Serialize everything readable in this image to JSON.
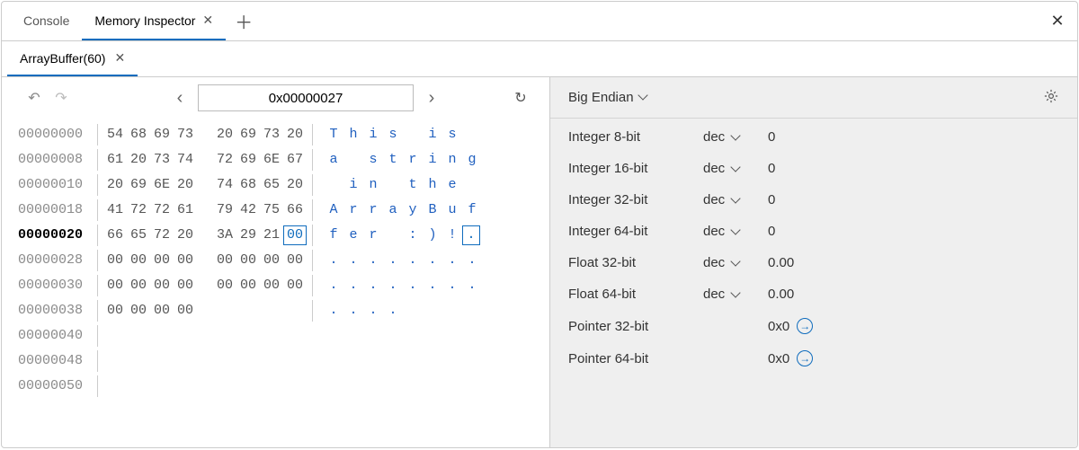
{
  "tabs": {
    "items": [
      {
        "label": "Console",
        "active": false,
        "closable": false
      },
      {
        "label": "Memory Inspector",
        "active": true,
        "closable": true
      }
    ]
  },
  "subtabs": {
    "items": [
      {
        "label": "ArrayBuffer(60)",
        "active": true
      }
    ]
  },
  "toolbar": {
    "address": "0x00000027"
  },
  "memory": {
    "selected_row_offset": "00000020",
    "selected_byte_col": 7,
    "rows": [
      {
        "offset": "00000000",
        "bytes": [
          "54",
          "68",
          "69",
          "73",
          "20",
          "69",
          "73",
          "20"
        ],
        "ascii": [
          "T",
          "h",
          "i",
          "s",
          " ",
          "i",
          "s",
          " "
        ]
      },
      {
        "offset": "00000008",
        "bytes": [
          "61",
          "20",
          "73",
          "74",
          "72",
          "69",
          "6E",
          "67"
        ],
        "ascii": [
          "a",
          " ",
          "s",
          "t",
          "r",
          "i",
          "n",
          "g"
        ]
      },
      {
        "offset": "00000010",
        "bytes": [
          "20",
          "69",
          "6E",
          "20",
          "74",
          "68",
          "65",
          "20"
        ],
        "ascii": [
          " ",
          "i",
          "n",
          " ",
          "t",
          "h",
          "e",
          " "
        ]
      },
      {
        "offset": "00000018",
        "bytes": [
          "41",
          "72",
          "72",
          "61",
          "79",
          "42",
          "75",
          "66"
        ],
        "ascii": [
          "A",
          "r",
          "r",
          "a",
          "y",
          "B",
          "u",
          "f"
        ]
      },
      {
        "offset": "00000020",
        "bytes": [
          "66",
          "65",
          "72",
          "20",
          "3A",
          "29",
          "21",
          "00"
        ],
        "ascii": [
          "f",
          "e",
          "r",
          " ",
          ":",
          ")",
          "!",
          "."
        ]
      },
      {
        "offset": "00000028",
        "bytes": [
          "00",
          "00",
          "00",
          "00",
          "00",
          "00",
          "00",
          "00"
        ],
        "ascii": [
          ".",
          ".",
          ".",
          ".",
          ".",
          ".",
          ".",
          "."
        ]
      },
      {
        "offset": "00000030",
        "bytes": [
          "00",
          "00",
          "00",
          "00",
          "00",
          "00",
          "00",
          "00"
        ],
        "ascii": [
          ".",
          ".",
          ".",
          ".",
          ".",
          ".",
          ".",
          "."
        ]
      },
      {
        "offset": "00000038",
        "bytes": [
          "00",
          "00",
          "00",
          "00"
        ],
        "ascii": [
          ".",
          ".",
          ".",
          "."
        ]
      },
      {
        "offset": "00000040",
        "bytes": [],
        "ascii": []
      },
      {
        "offset": "00000048",
        "bytes": [],
        "ascii": []
      },
      {
        "offset": "00000050",
        "bytes": [],
        "ascii": []
      }
    ]
  },
  "inspector": {
    "endianness_label": "Big Endian",
    "rows": [
      {
        "label": "Integer 8-bit",
        "format": "dec",
        "value": "0"
      },
      {
        "label": "Integer 16-bit",
        "format": "dec",
        "value": "0"
      },
      {
        "label": "Integer 32-bit",
        "format": "dec",
        "value": "0"
      },
      {
        "label": "Integer 64-bit",
        "format": "dec",
        "value": "0"
      },
      {
        "label": "Float 32-bit",
        "format": "dec",
        "value": "0.00"
      },
      {
        "label": "Float 64-bit",
        "format": "dec",
        "value": "0.00"
      },
      {
        "label": "Pointer 32-bit",
        "format": "",
        "value": "0x0",
        "jump": true
      },
      {
        "label": "Pointer 64-bit",
        "format": "",
        "value": "0x0",
        "jump": true
      }
    ]
  }
}
